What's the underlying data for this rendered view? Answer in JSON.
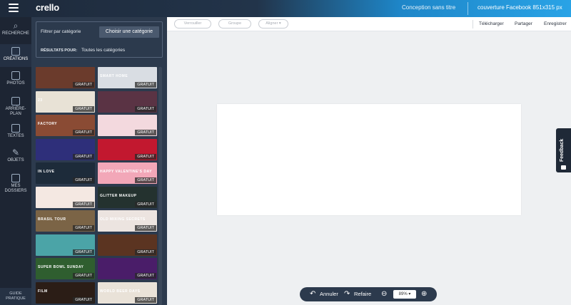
{
  "app": {
    "name": "crello"
  },
  "topbar": {
    "doc_title": "Conception sans titre",
    "doc_size": "couverture Facebook 851x315 px"
  },
  "rail": {
    "items": [
      {
        "label": "RECHERCHE",
        "icon": "search-icon"
      },
      {
        "label": "CRÉATIONS",
        "icon": "layout-icon"
      },
      {
        "label": "PHOTOS",
        "icon": "image-icon"
      },
      {
        "label": "ARRIÈRE-PLAN",
        "icon": "background-icon"
      },
      {
        "label": "TEXTES",
        "icon": "text-icon"
      },
      {
        "label": "OBJETS",
        "icon": "objects-icon"
      },
      {
        "label": "MES DOSSIERS",
        "icon": "folder-icon"
      }
    ],
    "guide": "GUIDE PRATIQUE"
  },
  "panel": {
    "filter_label": "Filtrer par catégorie",
    "filter_button": "Choisir une catégorie",
    "results_label": "RÉSULTATS POUR:",
    "results_value": "Toutes les catégories",
    "badge": "GRATUIT",
    "thumbs": [
      {
        "caption": "",
        "color": "#6b3b2c",
        "badge": true
      },
      {
        "caption": "SMART HOME",
        "color": "#d9dde3",
        "badge": true
      },
      {
        "caption": "23",
        "color": "#e8e2d6",
        "badge": true
      },
      {
        "caption": "",
        "color": "#5a3344",
        "badge": true
      },
      {
        "caption": "FACTORY",
        "color": "#8a4b34",
        "badge": true
      },
      {
        "caption": "",
        "color": "#f3d9de",
        "badge": true
      },
      {
        "caption": "",
        "color": "#2e2f7a",
        "badge": true
      },
      {
        "caption": "",
        "color": "#c2182f",
        "badge": true
      },
      {
        "caption": "IN LOVE",
        "color": "#1d2b3a",
        "badge": true
      },
      {
        "caption": "HAPPY VALENTINE'S DAY",
        "color": "#f2a7b8",
        "badge": true
      },
      {
        "caption": "",
        "color": "#f4e8e2",
        "badge": true
      },
      {
        "caption": "GLITTER MAKEUP",
        "color": "#24322f",
        "badge": true
      },
      {
        "caption": "BRASIL TOUR",
        "color": "#7b6446",
        "badge": true
      },
      {
        "caption": "OLD MIXING SECRETS",
        "color": "#ece4e0",
        "badge": true
      },
      {
        "caption": "",
        "color": "#4ba4a7",
        "badge": true
      },
      {
        "caption": "",
        "color": "#5b3421",
        "badge": true
      },
      {
        "caption": "SUPER BOWL SUNDAY",
        "color": "#2f5e2f",
        "badge": true
      },
      {
        "caption": "",
        "color": "#4a1d69",
        "badge": true
      },
      {
        "caption": "FILM",
        "color": "#2b1d16",
        "badge": true
      },
      {
        "caption": "WORLD BEER DAYS",
        "color": "#e9e2d8",
        "badge": true
      }
    ]
  },
  "toolbar": {
    "pills": [
      "Verrouiller",
      "Groupe",
      "Aligner ▾"
    ],
    "actions": [
      "Télécharger",
      "Partager",
      "Enregistrer"
    ]
  },
  "bottom": {
    "undo": "Annuler",
    "redo": "Refaire",
    "zoom": "89%"
  },
  "feedback": "Feedback"
}
